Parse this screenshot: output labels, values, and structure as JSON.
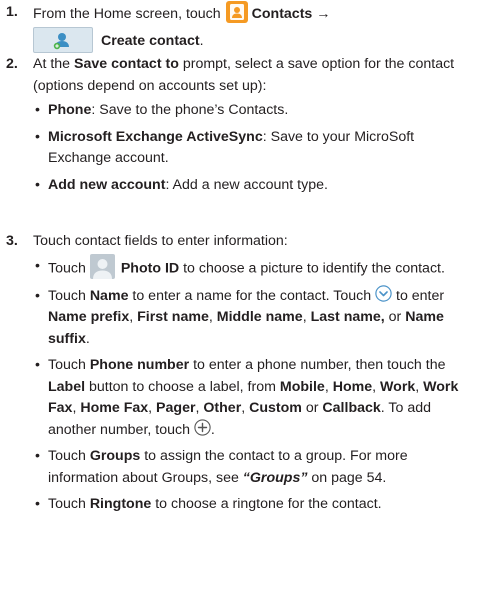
{
  "steps": [
    {
      "number": "1.",
      "parts": {
        "a": "From the Home screen, touch ",
        "contacts": "Contacts",
        "arrow": " →",
        "create": "Create contact",
        "end": "."
      }
    },
    {
      "number": "2.",
      "parts": {
        "a": "At the ",
        "b": "Save contact to",
        "c": " prompt, select a save option for the contact (options depend on accounts set up):"
      },
      "bullets": [
        {
          "term": "Phone",
          "text": ": Save to the phone’s Contacts."
        },
        {
          "term": "Microsoft Exchange ActiveSync",
          "text": ": Save to your MicroSoft Exchange account."
        },
        {
          "term": "Add new account",
          "text": ": Add a new account type."
        }
      ]
    },
    {
      "number": "3.",
      "intro": "Touch contact fields to enter information:",
      "bullets": [
        {
          "a": "Touch ",
          "b": "Photo ID",
          "c": " to choose a picture to identify the contact."
        },
        {
          "a": "Touch ",
          "b": "Name",
          "c": " to enter a name for the contact. Touch ",
          "d": " to enter ",
          "e": "Name prefix",
          "f": ", ",
          "g": "First name",
          "h": ", ",
          "i": "Middle name",
          "j": ", ",
          "k": "Last name,",
          "l": " or ",
          "m": "Name suffix",
          "n": "."
        },
        {
          "a": "Touch ",
          "b": "Phone number",
          "c": " to enter a phone number, then touch the ",
          "d": "Label",
          "e": " button to choose a label, from ",
          "f": "Mobile",
          "g": ", ",
          "h": "Home",
          "i": ", ",
          "j": "Work",
          "k": ", ",
          "l": "Work Fax",
          "m": ", ",
          "n": "Home Fax",
          "o": ", ",
          "p": "Pager",
          "q": ", ",
          "r": "Other",
          "s": ", ",
          "t": "Custom",
          "u": " or ",
          "v": "Callback",
          "w": ". To add another number, touch ",
          "x": "."
        },
        {
          "a": "Touch ",
          "b": "Groups",
          "c": " to assign the contact to a group. For more information about Groups, see ",
          "d": "“Groups”",
          "e": " on page 54."
        },
        {
          "a": "Touch ",
          "b": "Ringtone",
          "c": " to choose a ringtone for the contact."
        }
      ]
    }
  ],
  "icons": {
    "contacts": "contacts-app-icon",
    "create_contact": "add-contact-icon",
    "photo_id": "photo-id-icon",
    "expand": "chevron-down-circle-icon",
    "add": "plus-circle-icon"
  },
  "colors": {
    "contacts_icon": "#f59a23",
    "circle_icon": "#4b93c8"
  }
}
